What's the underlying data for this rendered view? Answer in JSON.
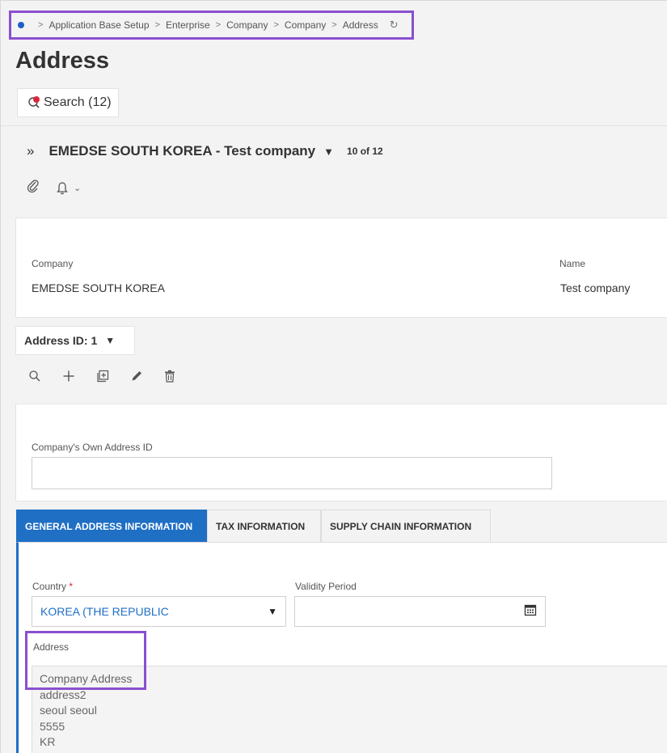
{
  "breadcrumb": [
    "Application Base Setup",
    "Enterprise",
    "Company",
    "Company",
    "Address"
  ],
  "page": {
    "title": "Address"
  },
  "search": {
    "label": "Search (12)"
  },
  "record": {
    "title": "EMEDSE SOUTH KOREA - Test company",
    "count": "10 of 12"
  },
  "company_card": {
    "company_label": "Company",
    "company_value": "EMEDSE SOUTH KOREA",
    "name_label": "Name",
    "name_value": "Test company"
  },
  "address_id": {
    "label": "Address ID: 1"
  },
  "own_address": {
    "label": "Company's Own Address ID",
    "value": ""
  },
  "tabs": [
    {
      "label": "GENERAL ADDRESS INFORMATION",
      "active": true
    },
    {
      "label": "TAX INFORMATION",
      "active": false
    },
    {
      "label": "SUPPLY CHAIN INFORMATION",
      "active": false
    }
  ],
  "general": {
    "country_label": "Country",
    "required_mark": "*",
    "country_value": "KOREA (THE REPUBLIC",
    "validity_label": "Validity Period",
    "validity_value": "",
    "address_label": "Address",
    "address_lines": [
      "Company Address",
      "address2",
      "seoul seoul",
      "5555",
      "KR"
    ]
  },
  "colors": {
    "accent": "#1f6fc5",
    "highlight": "#8a4fd0",
    "required": "#d9263c"
  }
}
